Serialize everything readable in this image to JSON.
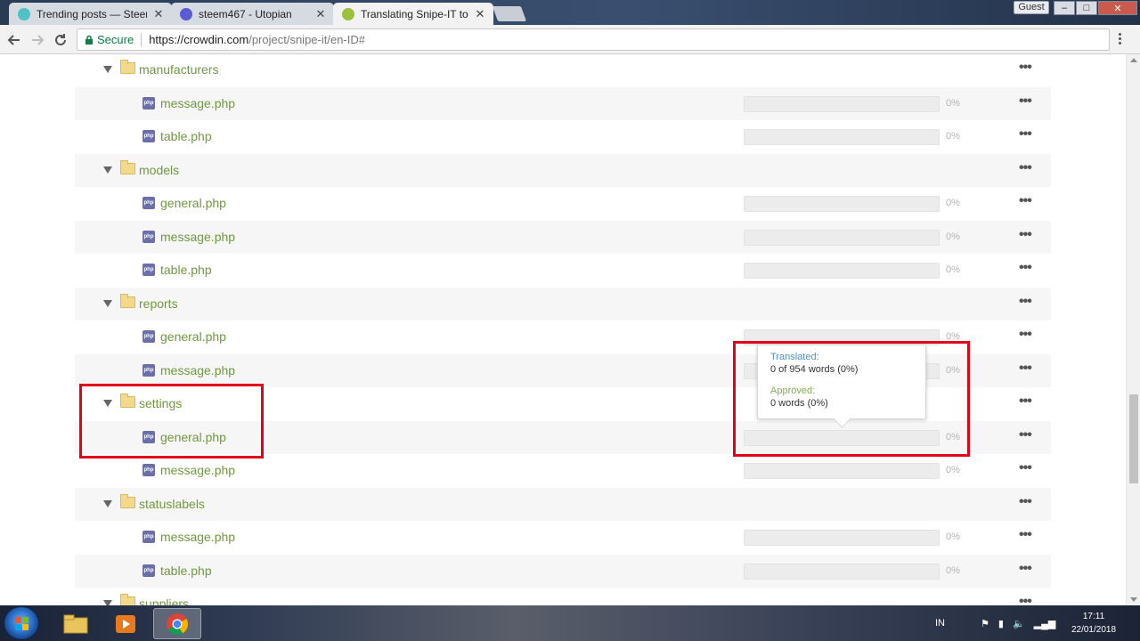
{
  "browser": {
    "tabs": [
      {
        "title": "Trending posts — Steem",
        "icon_color": "#4fc3c3",
        "active": false
      },
      {
        "title": "steem467 - Utopian",
        "icon_color": "#5b5bd6",
        "active": false
      },
      {
        "title": "Translating Snipe-IT to E",
        "icon_color": "#9ac23c",
        "active": true
      }
    ],
    "close_glyph": "✕",
    "guest_label": "Guest",
    "window_buttons": {
      "minimize": "–",
      "maximize": "□",
      "close": "✕"
    },
    "secure_label": "Secure",
    "url_scheme": "https://",
    "url_host": "crowdin.com",
    "url_path": "/project/snipe-it/en-ID#"
  },
  "tree": {
    "more_glyph": "•••",
    "rows": [
      {
        "type": "folder",
        "name": "manufacturers"
      },
      {
        "type": "file",
        "name": "message.php",
        "percent": "0%"
      },
      {
        "type": "file",
        "name": "table.php",
        "percent": "0%"
      },
      {
        "type": "folder",
        "name": "models"
      },
      {
        "type": "file",
        "name": "general.php",
        "percent": "0%"
      },
      {
        "type": "file",
        "name": "message.php",
        "percent": "0%"
      },
      {
        "type": "file",
        "name": "table.php",
        "percent": "0%"
      },
      {
        "type": "folder",
        "name": "reports"
      },
      {
        "type": "file",
        "name": "general.php",
        "percent": "0%"
      },
      {
        "type": "file",
        "name": "message.php",
        "percent": "0%"
      },
      {
        "type": "folder",
        "name": "settings"
      },
      {
        "type": "file",
        "name": "general.php",
        "percent": "0%"
      },
      {
        "type": "file",
        "name": "message.php",
        "percent": "0%"
      },
      {
        "type": "folder",
        "name": "statuslabels"
      },
      {
        "type": "file",
        "name": "message.php",
        "percent": "0%"
      },
      {
        "type": "file",
        "name": "table.php",
        "percent": "0%"
      },
      {
        "type": "folder",
        "name": "suppliers"
      }
    ],
    "php_badge": "php"
  },
  "tooltip": {
    "translated_label": "Translated:",
    "translated_value": "0 of 954 words (0%)",
    "approved_label": "Approved:",
    "approved_value": "0 words (0%)"
  },
  "taskbar": {
    "language": "IN",
    "time": "17:11",
    "date": "22/01/2018"
  },
  "colors": {
    "link_green": "#6f9a3e",
    "highlight_red": "#e2001a",
    "translated_blue": "#4f90c4",
    "approved_green": "#7fb24f"
  }
}
